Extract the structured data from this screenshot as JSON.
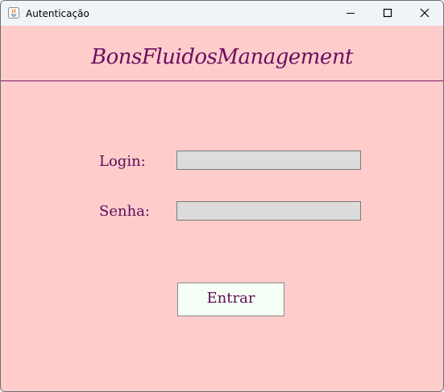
{
  "window": {
    "title": "Autenticação",
    "icon": "java-icon",
    "controls": {
      "minimize": "minimize-icon",
      "maximize": "maximize-icon",
      "close": "close-icon"
    }
  },
  "header": {
    "brand": "BonsFluidosManagement"
  },
  "form": {
    "login_label": "Login:",
    "login_value": "",
    "senha_label": "Senha:",
    "senha_value": "",
    "submit_label": "Entrar"
  },
  "colors": {
    "background": "#ffcccc",
    "brand": "#6a0f5f",
    "input_background": "#dcdcdc",
    "button_background": "#f5fff5"
  }
}
